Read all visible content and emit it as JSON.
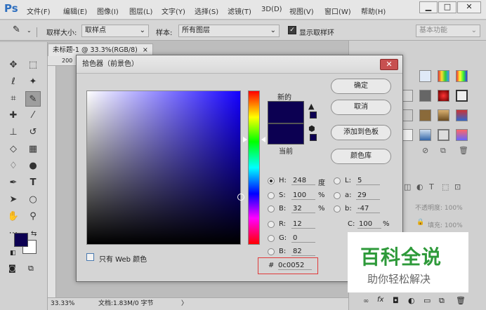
{
  "app": {
    "logo": "Ps",
    "menus": [
      "文件(F)",
      "编辑(E)",
      "图像(I)",
      "图层(L)",
      "文字(Y)",
      "选择(S)",
      "滤镜(T)",
      "3D(D)",
      "视图(V)",
      "窗口(W)",
      "帮助(H)"
    ],
    "win_buttons": [
      "▁",
      "□",
      "✕"
    ]
  },
  "options": {
    "sample_size_label": "取样大小:",
    "sample_size_value": "取样点",
    "sample_label": "样本:",
    "sample_value": "所有图层",
    "show_ring_label": "显示取样环",
    "workspace": "基本功能"
  },
  "document": {
    "tab_title": "未标题-1 @ 33.3%(RGB/8)",
    "tab_close": "×",
    "ruler_first": "200",
    "zoom": "33.33%",
    "doc_info": "文档:1.83M/0 字节",
    "status_arrow": "〉"
  },
  "dialog": {
    "title": "拾色器（前景色）",
    "close": "✕",
    "new_label": "新的",
    "current_label": "当前",
    "web_only": "只有 Web 颜色",
    "buttons": {
      "ok": "确定",
      "cancel": "取消",
      "add_swatch": "添加到色板",
      "color_libraries": "颜色库"
    },
    "fields": {
      "H": {
        "label": "H:",
        "value": "248",
        "unit": "度"
      },
      "S": {
        "label": "S:",
        "value": "100",
        "unit": "%"
      },
      "Bv": {
        "label": "B:",
        "value": "32",
        "unit": "%"
      },
      "R": {
        "label": "R:",
        "value": "12"
      },
      "G": {
        "label": "G:",
        "value": "0"
      },
      "B": {
        "label": "B:",
        "value": "82"
      },
      "L": {
        "label": "L:",
        "value": "5"
      },
      "a": {
        "label": "a:",
        "value": "29"
      },
      "b": {
        "label": "b:",
        "value": "-47"
      },
      "C": {
        "label": "C:",
        "value": "100",
        "unit": "%"
      },
      "hex_prefix": "#",
      "hex": "0c0052"
    }
  },
  "panel": {
    "opacity_label": "不透明度: 100%",
    "fill_label": "填充: 100%",
    "fx": "fx",
    "lock_icon": "🔒"
  },
  "watermark": {
    "title": "百科全说",
    "subtitle": "助你轻松解决"
  },
  "colors": {
    "foreground": "#0c0052",
    "background": "#ffffff"
  }
}
